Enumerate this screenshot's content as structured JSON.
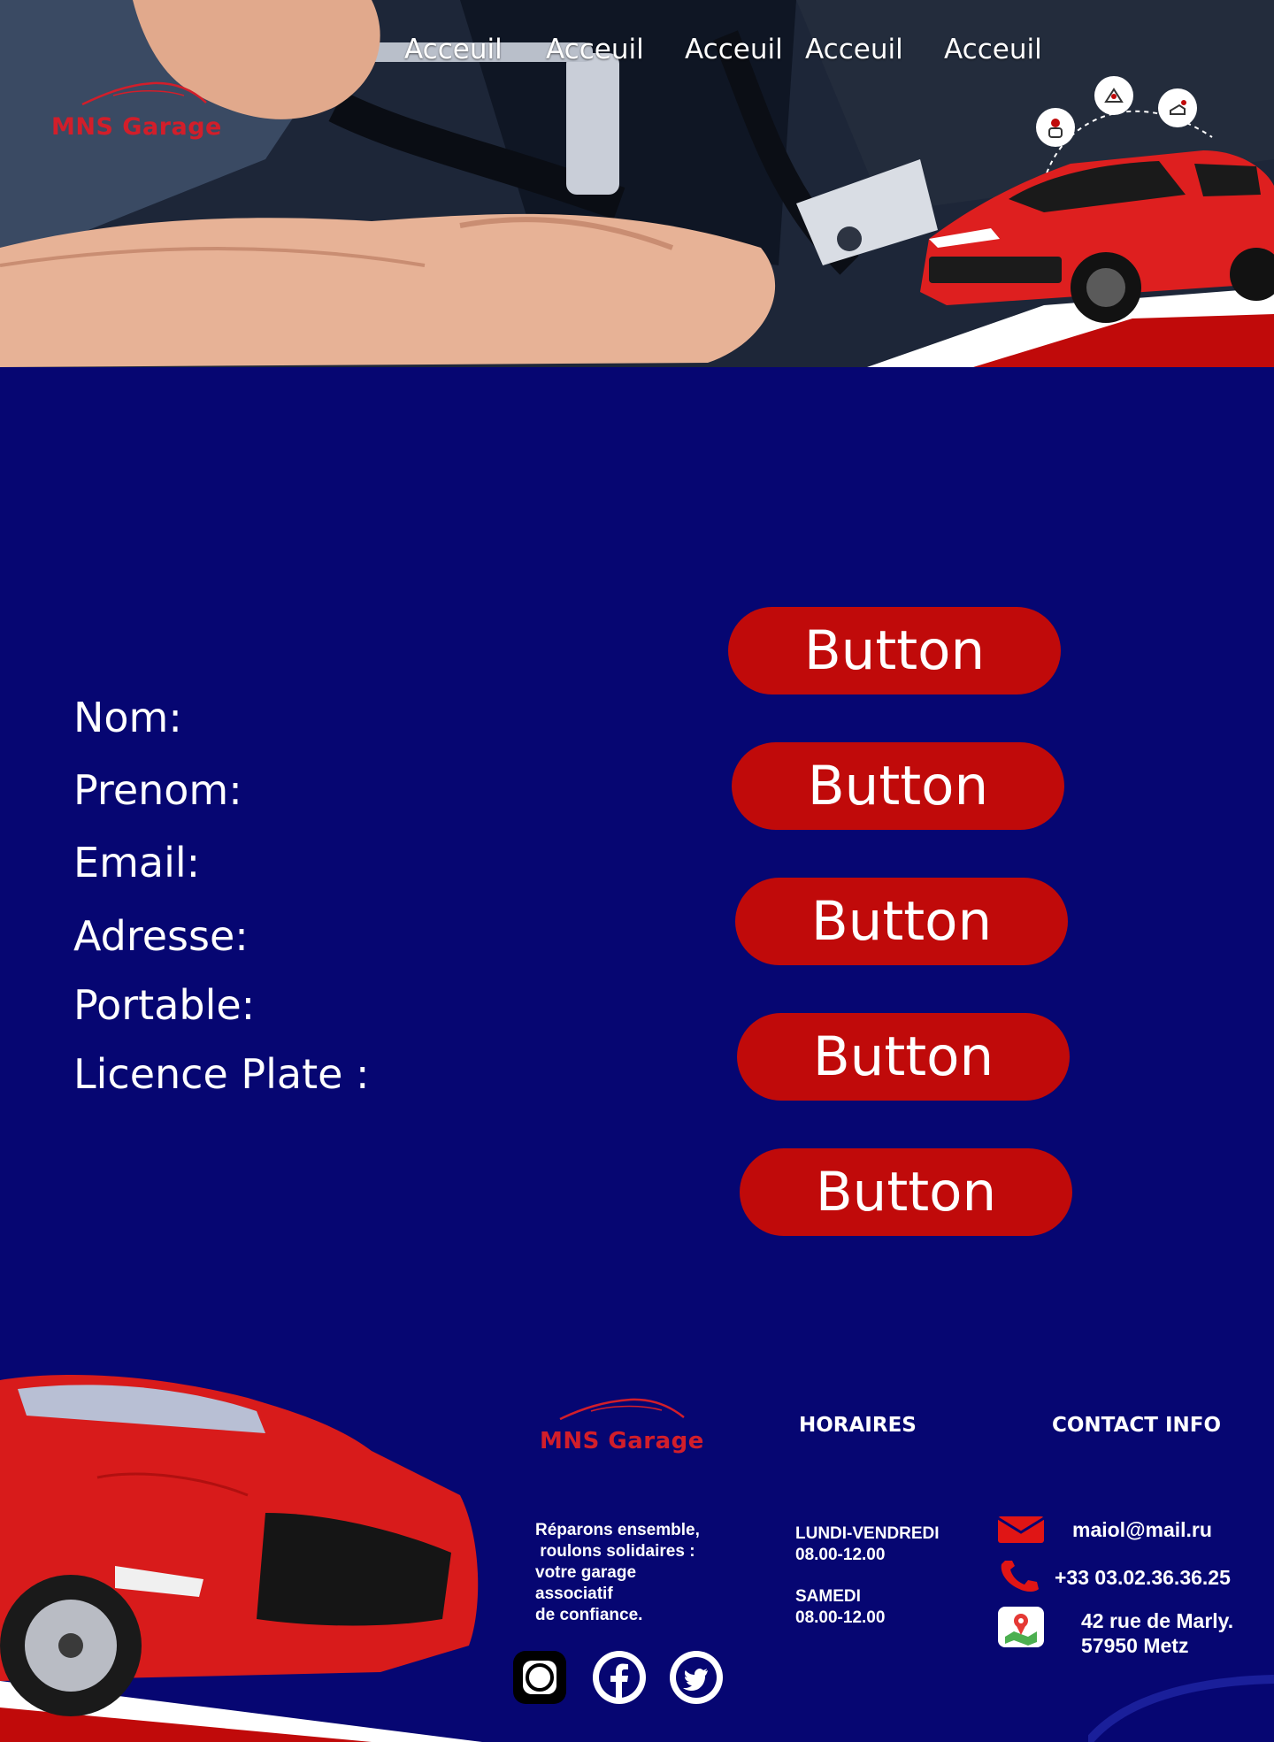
{
  "brand": {
    "name": "MNS Garage",
    "color": "#d21e2a"
  },
  "nav": {
    "items": [
      {
        "label": "Acceuil"
      },
      {
        "label": "Acceuil"
      },
      {
        "label": "Acceuil"
      },
      {
        "label": "Acceuil"
      },
      {
        "label": "Acceuil"
      }
    ]
  },
  "hero": {
    "service_icons": [
      "mechanic-icon",
      "car-jack-icon",
      "oil-change-icon"
    ],
    "image": "engine-repair-photo",
    "car": "red-suv"
  },
  "form": {
    "labels": [
      "Nom:",
      "Prenom:",
      "Email:",
      "Adresse:",
      "Portable:",
      "Licence Plate :"
    ],
    "buttons": [
      "Button",
      "Button",
      "Button",
      "Button",
      "Button"
    ],
    "button_color": "#c00a0a"
  },
  "footer": {
    "logo": "MNS Garage",
    "tagline": "Réparons ensemble,\n roulons solidaires :\nvotre garage\nassociatif\nde confiance.",
    "hours_title": "HORAIRES",
    "hours_weekdays": "LUNDI-VENDREDI\n08.00-12.00",
    "hours_saturday": "SAMEDI\n08.00-12.00",
    "contact_title": "CONTACT INFO",
    "email": "maiol@mail.ru",
    "phone": "+33 03.02.36.36.25",
    "address": "42 rue de Marly.\n57950 Metz",
    "socials": [
      "instagram-icon",
      "facebook-icon",
      "twitter-icon"
    ]
  },
  "colors": {
    "background": "#060672",
    "accent": "#c00a0a"
  }
}
